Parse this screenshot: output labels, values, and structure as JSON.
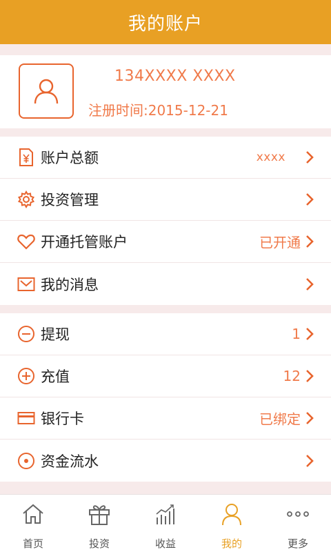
{
  "header": {
    "title": "我的账户"
  },
  "profile": {
    "phone": "134XXXX XXXX",
    "register_time": "注册时间:2015-12-21"
  },
  "menu_group1": [
    {
      "label": "账户总额",
      "value": "xxxx",
      "icon": "receipt-yen-icon"
    },
    {
      "label": "投资管理",
      "value": "",
      "icon": "gear-icon"
    },
    {
      "label": "开通托管账户",
      "value": "已开通",
      "icon": "heart-icon"
    },
    {
      "label": "我的消息",
      "value": "",
      "icon": "envelope-icon"
    }
  ],
  "menu_group2": [
    {
      "label": "提现",
      "value": "1",
      "icon": "minus-circle-icon"
    },
    {
      "label": "充值",
      "value": "12",
      "icon": "plus-circle-icon"
    },
    {
      "label": "银行卡",
      "value": "已绑定",
      "icon": "card-icon"
    },
    {
      "label": "资金流水",
      "value": "",
      "icon": "dot-circle-icon"
    }
  ],
  "tabbar": [
    {
      "label": "首页",
      "icon": "home-icon",
      "active": false
    },
    {
      "label": "投资",
      "icon": "gift-icon",
      "active": false
    },
    {
      "label": "收益",
      "icon": "bar-chart-icon",
      "active": false
    },
    {
      "label": "我的",
      "icon": "user-icon",
      "active": true
    },
    {
      "label": "更多",
      "icon": "more-dots-icon",
      "active": false
    }
  ],
  "colors": {
    "brand": "#e8a024",
    "accent": "#e8642d",
    "value_text": "#f07a4a",
    "background": "#f7eaea"
  }
}
